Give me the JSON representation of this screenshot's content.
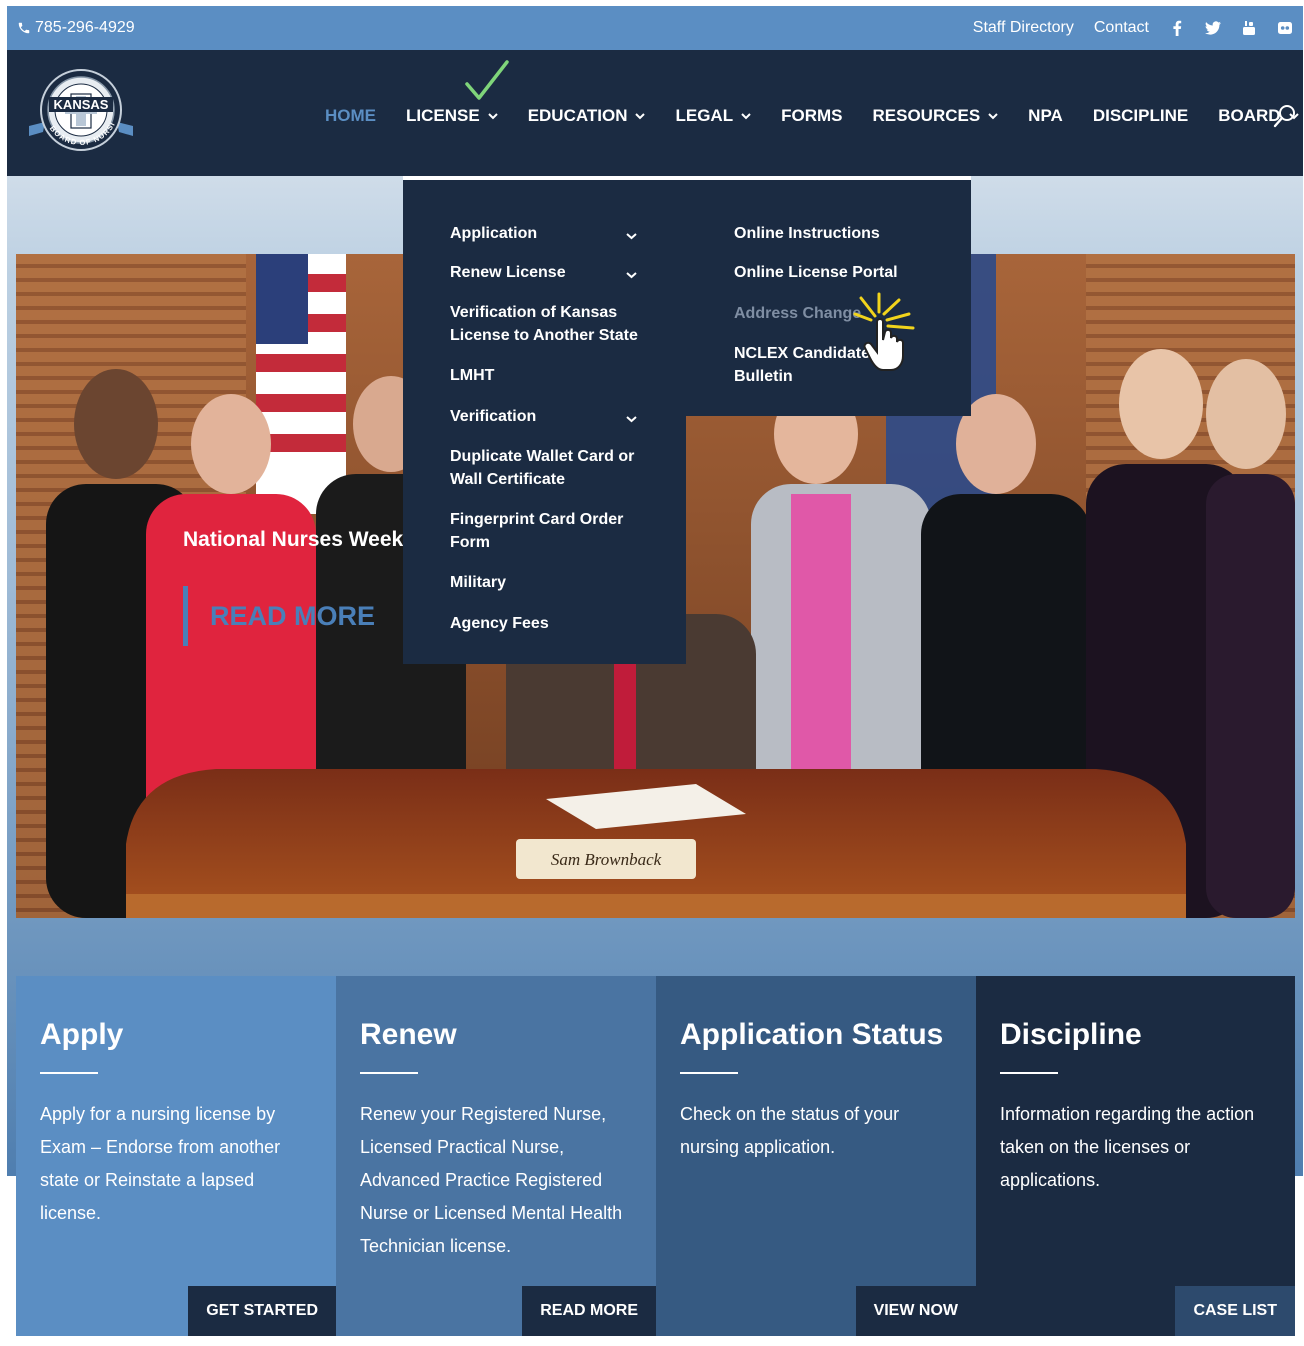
{
  "topbar": {
    "phone": "785-296-4929",
    "links": [
      "Staff Directory",
      "Contact"
    ],
    "social_icons": [
      "facebook-icon",
      "twitter-icon",
      "youtube-icon",
      "flickr-icon"
    ]
  },
  "nav": {
    "logo": {
      "top_text": "KANSAS",
      "ring_text": "BOARD OF NURSING"
    },
    "items": [
      {
        "label": "HOME",
        "active": true,
        "dropdown": false
      },
      {
        "label": "LICENSE",
        "active": false,
        "dropdown": true
      },
      {
        "label": "EDUCATION",
        "active": false,
        "dropdown": true
      },
      {
        "label": "LEGAL",
        "active": false,
        "dropdown": true
      },
      {
        "label": "FORMS",
        "active": false,
        "dropdown": false
      },
      {
        "label": "RESOURCES",
        "active": false,
        "dropdown": true
      },
      {
        "label": "NPA",
        "active": false,
        "dropdown": false
      },
      {
        "label": "DISCIPLINE",
        "active": false,
        "dropdown": false
      },
      {
        "label": "BOARD",
        "active": false,
        "dropdown": true
      }
    ],
    "accent": "#5b8ec3"
  },
  "license_menu": {
    "left": [
      {
        "label": "Application",
        "submenu": true
      },
      {
        "label": "Renew License",
        "submenu": true
      },
      {
        "label": "Verification of Kansas License to Another State",
        "submenu": false
      },
      {
        "label": "LMHT",
        "submenu": false
      },
      {
        "label": "Verification",
        "submenu": true
      },
      {
        "label": "Duplicate Wallet Card or Wall Certificate",
        "submenu": false
      },
      {
        "label": "Fingerprint Card Order Form",
        "submenu": false
      },
      {
        "label": "Military",
        "submenu": false
      },
      {
        "label": "Agency Fees",
        "submenu": false
      }
    ],
    "right": [
      {
        "label": "Online Instructions",
        "hovered": false
      },
      {
        "label": "Online License Portal",
        "hovered": false
      },
      {
        "label": "Address Change",
        "hovered": true
      },
      {
        "label": "NCLEX Candidate Bulletin",
        "hovered": false
      }
    ]
  },
  "hero": {
    "caption": "National Nurses Week 2",
    "read_more": "READ MORE",
    "nameplate": "Sam Brownback"
  },
  "cards": [
    {
      "title": "Apply",
      "text": "Apply for a nursing license by Exam – Endorse from another state or Reinstate a lapsed license.",
      "button": "GET STARTED"
    },
    {
      "title": "Renew",
      "text": "Renew your Registered Nurse, Licensed Practical Nurse, Advanced Practice Registered Nurse or Licensed Mental Health Technician license.",
      "button": "READ MORE"
    },
    {
      "title": "Application Status",
      "text": "Check on the status of your nursing application.",
      "button": "VIEW NOW"
    },
    {
      "title": "Discipline",
      "text": "Information regarding the action taken on the licenses or applications.",
      "button": "CASE LIST"
    }
  ]
}
